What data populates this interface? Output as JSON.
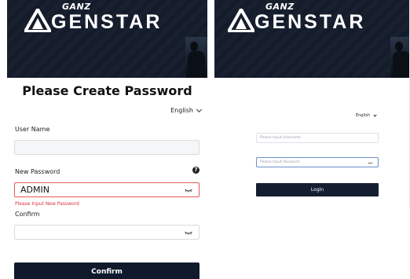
{
  "brand": {
    "small": "GANZ",
    "large": "GENSTAR"
  },
  "create_password": {
    "title": "Please Create Password",
    "language": "English",
    "username_label": "User Name",
    "username_value": "",
    "new_password_label": "New Password",
    "new_password_value": "ADMIN",
    "help_glyph": "?",
    "error": "Please Input New Password",
    "confirm_label": "Confirm",
    "confirm_value": "",
    "submit_label": "Confirm"
  },
  "login": {
    "language": "English",
    "username_placeholder": "Please Input Username",
    "password_placeholder": "Please Input Password",
    "submit_label": "Login"
  },
  "colors": {
    "banner": "#141c2c",
    "button": "#101a2c",
    "error": "#d9363e",
    "focus_border": "#6a8fc9"
  },
  "icons": [
    "ganz-logo-icon",
    "eye-closed-icon",
    "chevron-down-icon",
    "help-icon"
  ]
}
